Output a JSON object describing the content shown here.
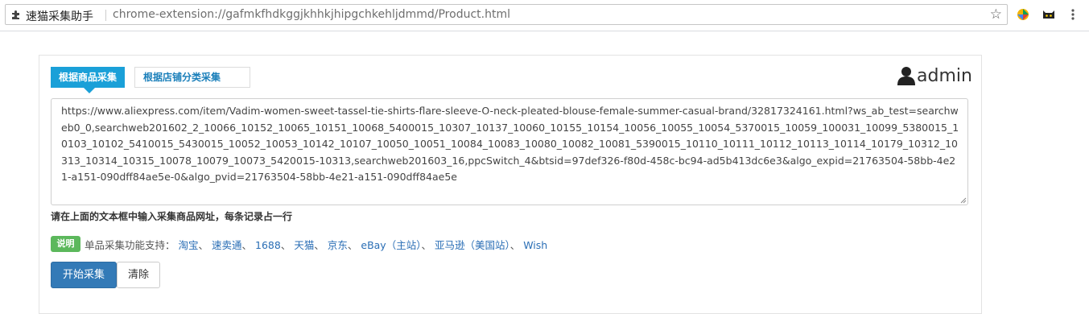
{
  "browser": {
    "site_name": "速猫采集助手",
    "url": "chrome-extension://gafmkfhdkggjkhhkjhipgchkehljdmmd/Product.html"
  },
  "tabs": [
    {
      "label": "根据商品采集",
      "active": true
    },
    {
      "label": "根据店铺分类采集",
      "active": false
    }
  ],
  "user": {
    "name": "admin"
  },
  "url_textarea": {
    "value": "https://www.aliexpress.com/item/Vadim-women-sweet-tassel-tie-shirts-flare-sleeve-O-neck-pleated-blouse-female-summer-casual-brand/32817324161.html?ws_ab_test=searchweb0_0,searchweb201602_2_10066_10152_10065_10151_10068_5400015_10307_10137_10060_10155_10154_10056_10055_10054_5370015_10059_100031_10099_5380015_10103_10102_5410015_5430015_10052_10053_10142_10107_10050_10051_10084_10083_10080_10082_10081_5390015_10110_10111_10112_10113_10114_10179_10312_10313_10314_10315_10078_10079_10073_5420015-10313,searchweb201603_16,ppcSwitch_4&btsid=97def326-f80d-458c-bc94-ad5b413dc6e3&algo_expid=21763504-58bb-4e21-a151-090dff84ae5e-0&algo_pvid=21763504-58bb-4e21-a151-090dff84ae5e"
  },
  "hint": "请在上面的文本框中输入采集商品网址，每条记录占一行",
  "note": {
    "badge": "说明",
    "prefix": "单品采集功能支持：",
    "sep": "、",
    "platforms": [
      "淘宝",
      "速卖通",
      "1688",
      "天猫",
      "京东",
      "eBay（主站）",
      "亚马逊（美国站）",
      "Wish"
    ]
  },
  "buttons": {
    "start": "开始采集",
    "clear": "清除"
  },
  "colors": {
    "tab_active": "#1aa0d8",
    "primary": "#337ab7",
    "badge": "#5cb85c",
    "link": "#2a6eb5"
  }
}
